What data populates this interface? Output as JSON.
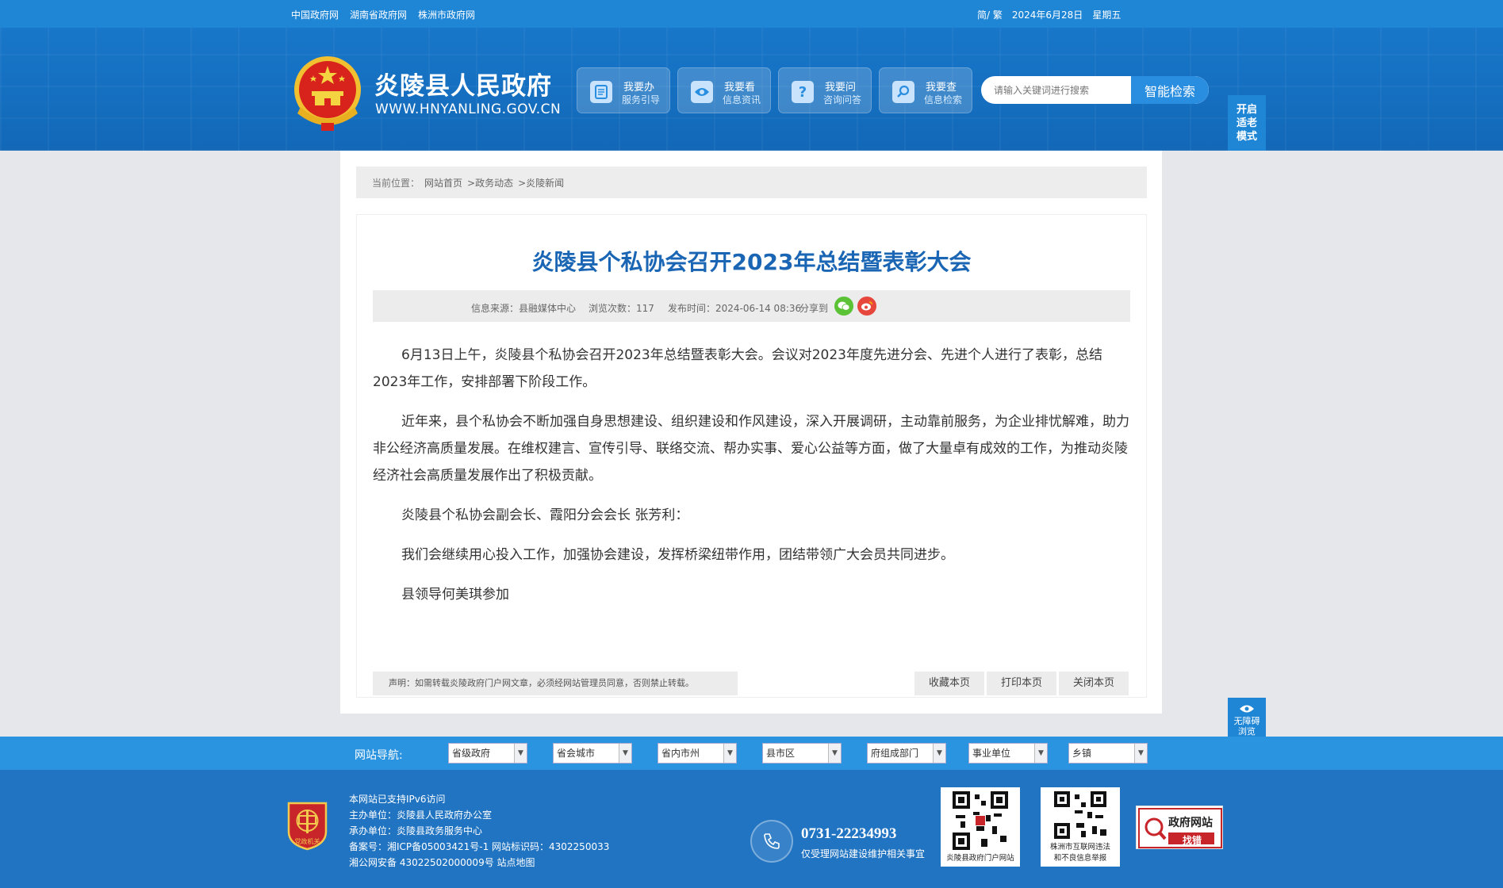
{
  "topbar": {
    "links": [
      "中国政府网",
      "湖南省政府网",
      "株洲市政府网"
    ],
    "lang": "简/ 繁",
    "date": "2024年6月28日",
    "weekday": "星期五"
  },
  "header": {
    "title": "炎陵县人民政府",
    "domain": "WWW.HNYANLING.GOV.CN",
    "services": [
      {
        "t1": "我要办",
        "t2": "服务引导",
        "icon": "document-icon"
      },
      {
        "t1": "我要看",
        "t2": "信息资讯",
        "icon": "eye-icon"
      },
      {
        "t1": "我要问",
        "t2": "咨询问答",
        "icon": "question-icon"
      },
      {
        "t1": "我要查",
        "t2": "信息检索",
        "icon": "search-icon"
      }
    ],
    "search_placeholder": "请输入关键词进行搜索",
    "search_button": "智能检索",
    "elder_mode": [
      "开启",
      "适老",
      "模式"
    ]
  },
  "breadcrumb": {
    "label": "当前位置：",
    "items": [
      "网站首页",
      ">政务动态",
      ">炎陵新闻"
    ]
  },
  "article": {
    "title": "炎陵县个私协会召开2023年总结暨表彰大会",
    "source": "信息来源：县融媒体中心",
    "views": "浏览次数：117",
    "published": "发布时间：2024-06-14 08:36",
    "share_label": "分享到",
    "paragraphs": [
      "6月13日上午，炎陵县个私协会召开2023年总结暨表彰大会。会议对2023年度先进分会、先进个人进行了表彰，总结2023年工作，安排部署下阶段工作。",
      "近年来，县个私协会不断加强自身思想建设、组织建设和作风建设，深入开展调研，主动靠前服务，为企业排忧解难，助力非公经济高质量发展。在维权建言、宣传引导、联络交流、帮办实事、爱心公益等方面，做了大量卓有成效的工作，为推动炎陵经济社会高质量发展作出了积极贡献。",
      "炎陵县个私协会副会长、霞阳分会会长 张芳利：",
      "我们会继续用心投入工作，加强协会建设，发挥桥梁纽带作用，团结带领广大会员共同进步。",
      "县领导何美琪参加"
    ],
    "notice": "声明：如需转载炎陵政府门户网文章，必须经网站管理员同意，否则禁止转载。",
    "actions": [
      "收藏本页",
      "打印本页",
      "关闭本页"
    ]
  },
  "a11y": {
    "line1": "无障碍",
    "line2": "浏览"
  },
  "footnav": {
    "label": "网站导航:",
    "selects": [
      "省级政府",
      "省会城市",
      "省内市州",
      "县市区",
      "府组成部门",
      "事业单位",
      "乡镇"
    ]
  },
  "footer": {
    "badge": "党政机关",
    "lines": [
      "本网站已支持IPv6访问",
      "主办单位：炎陵县人民政府办公室",
      "承办单位：炎陵县政务服务中心",
      "备案号：湘ICP备05003421号-1 网站标识码：4302250033",
      "湘公网安备 43022502000009号 站点地图"
    ],
    "phone": "0731-22234993",
    "phone_note": "仅受理网站建设维护相关事宜",
    "qr1_caption": "炎陵县政府门户网站",
    "qr2_caption": [
      "株洲市互联网违法",
      "和不良信息举报"
    ],
    "findbug": [
      "政府网站",
      "找错"
    ]
  },
  "colors": {
    "brand_blue": "#1f86d6",
    "title_blue": "#1a66b4",
    "footer_blue": "#2174c2"
  }
}
